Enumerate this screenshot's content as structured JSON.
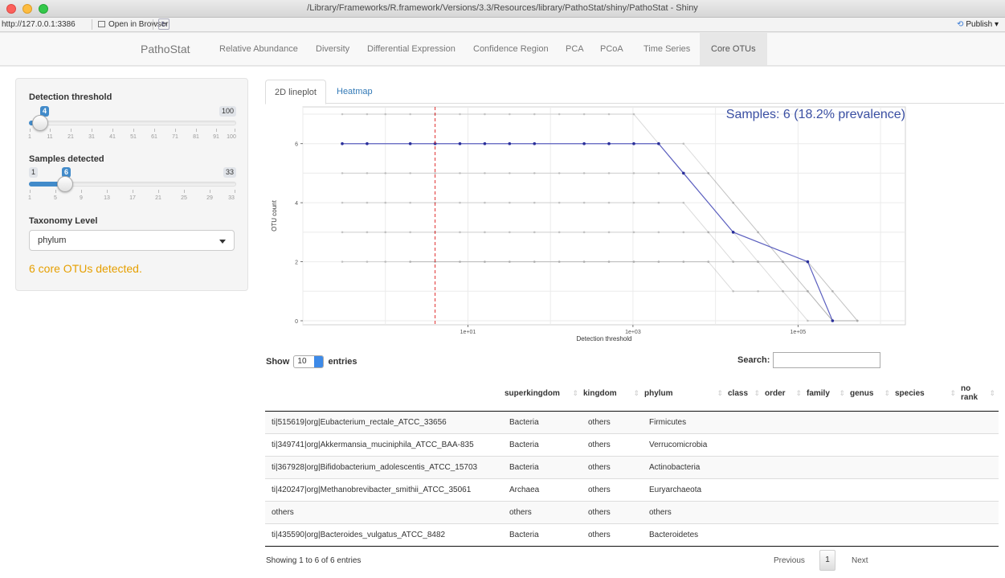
{
  "window": {
    "title": "/Library/Frameworks/R.framework/Versions/3.3/Resources/library/PathoStat/shiny/PathoStat - Shiny"
  },
  "viewer": {
    "url": "http://127.0.0.1:3386",
    "open_in_browser": "Open in Browser",
    "publish": "Publish"
  },
  "navbar": {
    "brand": "PathoStat",
    "items": [
      "Relative Abundance",
      "Diversity",
      "Differential Expression",
      "Confidence Region",
      "PCA",
      "PCoA",
      "Time Series",
      "Core OTUs"
    ],
    "active": "Core OTUs"
  },
  "sidebar": {
    "detection": {
      "label": "Detection threshold",
      "value": "4",
      "max": "100",
      "ticks": [
        "1",
        "11",
        "21",
        "31",
        "41",
        "51",
        "61",
        "71",
        "81",
        "91",
        "100"
      ]
    },
    "samples": {
      "label": "Samples detected",
      "min": "1",
      "value": "6",
      "max": "33",
      "ticks": [
        "1",
        "5",
        "9",
        "13",
        "17",
        "21",
        "25",
        "29",
        "33"
      ]
    },
    "taxonomy": {
      "label": "Taxonomy Level",
      "selected": "phylum"
    },
    "core_message": "6 core OTUs detected."
  },
  "tabs": [
    "2D lineplot",
    "Heatmap"
  ],
  "chart_data": {
    "type": "line",
    "title": "Samples: 6 (18.2% prevalence)",
    "xlabel": "Detection threshold",
    "ylabel": "OTU count",
    "x_scale": "log",
    "x_ticks": [
      "1e+01",
      "1e+03",
      "1e+05"
    ],
    "y_ticks": [
      "0",
      "2",
      "4",
      "6"
    ],
    "ylim": [
      0,
      7
    ],
    "xlim": [
      0.1,
      2000000
    ],
    "threshold_line": 4,
    "x": [
      0.3,
      0.6,
      1,
      2,
      4,
      8,
      16,
      32,
      64,
      128,
      256,
      512,
      1024,
      2048,
      4096,
      8192,
      16384,
      32768,
      65536,
      131072,
      262144,
      524288
    ],
    "highlight_series": {
      "name": "Samples: 6",
      "x": [
        0.3,
        0.6,
        2,
        4,
        8,
        16,
        32,
        64,
        256,
        512,
        1024,
        2048,
        4096,
        16384,
        131072,
        262144
      ],
      "values": [
        6,
        6,
        6,
        6,
        6,
        6,
        6,
        6,
        6,
        6,
        6,
        6,
        5,
        3,
        2,
        0
      ]
    },
    "background_series": [
      {
        "x": [
          0.3,
          0.6,
          1,
          2,
          4,
          8,
          16,
          32,
          64,
          128,
          256,
          512,
          1024,
          2048,
          4096,
          8192,
          16384,
          32768,
          65536,
          131072,
          262144,
          524288
        ],
        "values": [
          7,
          7,
          7,
          7,
          7,
          7,
          7,
          7,
          7,
          7,
          7,
          7,
          7,
          6,
          6,
          5,
          4,
          3,
          2,
          1,
          0,
          0
        ]
      },
      {
        "x": [
          0.3,
          0.6,
          1,
          2,
          4,
          8,
          16,
          32,
          64,
          128,
          256,
          512,
          1024,
          2048,
          4096,
          8192,
          16384,
          32768,
          65536,
          131072,
          262144,
          524288
        ],
        "values": [
          5,
          5,
          5,
          5,
          5,
          5,
          5,
          5,
          5,
          5,
          5,
          5,
          5,
          5,
          5,
          5,
          4,
          3,
          2,
          2,
          1,
          0
        ]
      },
      {
        "x": [
          0.3,
          0.6,
          1,
          2,
          4,
          8,
          16,
          32,
          64,
          128,
          256,
          512,
          1024,
          2048,
          4096,
          8192,
          16384,
          32768,
          65536,
          131072,
          262144,
          524288
        ],
        "values": [
          4,
          4,
          4,
          4,
          4,
          4,
          4,
          4,
          4,
          4,
          4,
          4,
          4,
          4,
          4,
          3,
          3,
          2,
          2,
          1,
          0,
          0
        ]
      },
      {
        "x": [
          0.3,
          0.6,
          1,
          2,
          4,
          8,
          16,
          32,
          64,
          128,
          256,
          512,
          1024,
          2048,
          4096,
          8192,
          16384,
          32768,
          65536,
          131072,
          262144,
          524288
        ],
        "values": [
          3,
          3,
          3,
          3,
          3,
          3,
          3,
          3,
          3,
          3,
          3,
          3,
          3,
          3,
          3,
          3,
          2,
          2,
          2,
          2,
          1,
          0
        ]
      },
      {
        "x": [
          0.3,
          0.6,
          1,
          2,
          4,
          8,
          16,
          32,
          64,
          128,
          256,
          512,
          1024,
          2048,
          4096,
          8192,
          16384,
          32768,
          65536,
          131072,
          262144,
          524288
        ],
        "values": [
          2,
          2,
          2,
          2,
          2,
          2,
          2,
          2,
          2,
          2,
          2,
          2,
          2,
          2,
          2,
          2,
          2,
          2,
          1,
          1,
          0,
          0
        ]
      },
      {
        "x": [
          2,
          4,
          8,
          16,
          32,
          64,
          128,
          256,
          512,
          1024,
          2048,
          4096,
          8192,
          16384,
          32768,
          65536,
          131072,
          262144
        ],
        "values": [
          2,
          2,
          2,
          2,
          2,
          2,
          2,
          2,
          2,
          2,
          2,
          2,
          2,
          1,
          1,
          1,
          0,
          0
        ]
      }
    ]
  },
  "table": {
    "show_label_pre": "Show",
    "length": "10",
    "show_label_post": "entries",
    "search_label": "Search:",
    "columns": [
      "",
      "superkingdom",
      "kingdom",
      "phylum",
      "class",
      "order",
      "family",
      "genus",
      "species",
      "no rank"
    ],
    "rows": [
      [
        "ti|515619|org|Eubacterium_rectale_ATCC_33656",
        "Bacteria",
        "others",
        "Firmicutes",
        "",
        "",
        "",
        "",
        "",
        ""
      ],
      [
        "ti|349741|org|Akkermansia_muciniphila_ATCC_BAA-835",
        "Bacteria",
        "others",
        "Verrucomicrobia",
        "",
        "",
        "",
        "",
        "",
        ""
      ],
      [
        "ti|367928|org|Bifidobacterium_adolescentis_ATCC_15703",
        "Bacteria",
        "others",
        "Actinobacteria",
        "",
        "",
        "",
        "",
        "",
        ""
      ],
      [
        "ti|420247|org|Methanobrevibacter_smithii_ATCC_35061",
        "Archaea",
        "others",
        "Euryarchaeota",
        "",
        "",
        "",
        "",
        "",
        ""
      ],
      [
        "others",
        "others",
        "others",
        "others",
        "",
        "",
        "",
        "",
        "",
        ""
      ],
      [
        "ti|435590|org|Bacteroides_vulgatus_ATCC_8482",
        "Bacteria",
        "others",
        "Bacteroidetes",
        "",
        "",
        "",
        "",
        "",
        ""
      ]
    ],
    "info": "Showing 1 to 6 of 6 entries",
    "previous": "Previous",
    "page": "1",
    "next": "Next"
  },
  "colors": {
    "accent": "#428bca",
    "highlight_line": "#5b5fbf",
    "threshold_line": "#e03030",
    "core_message": "#e69f00"
  }
}
